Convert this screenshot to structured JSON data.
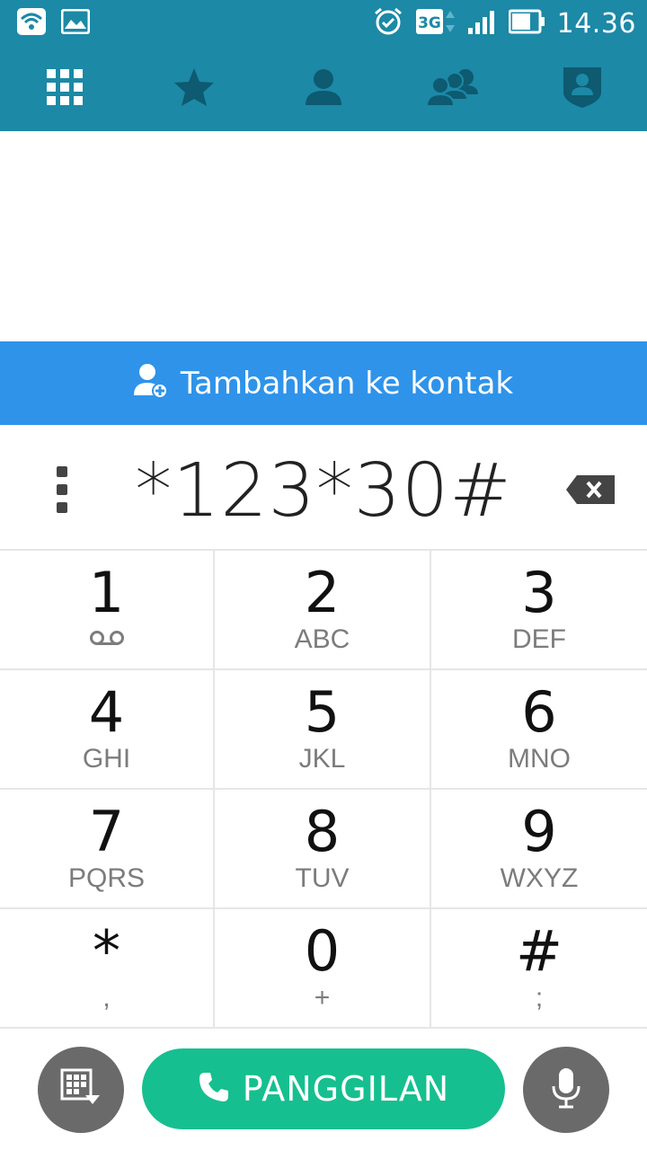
{
  "status_bar": {
    "time": "14.36",
    "network": "3G",
    "icons": [
      "wifi-icon",
      "image-notification-icon",
      "alarm-icon",
      "network-3g-icon",
      "signal-icon",
      "battery-icon"
    ]
  },
  "tabs": [
    {
      "name": "dialpad",
      "icon": "dialpad-grid-icon",
      "active": true
    },
    {
      "name": "favorites",
      "icon": "star-icon"
    },
    {
      "name": "contacts",
      "icon": "person-icon"
    },
    {
      "name": "groups",
      "icon": "group-icon"
    },
    {
      "name": "profile",
      "icon": "shield-person-icon"
    }
  ],
  "add_contact": {
    "label": "Tambahkan ke kontak",
    "icon": "add-person-icon"
  },
  "dialer": {
    "number": "*123*30#"
  },
  "keypad": [
    {
      "digit": "1",
      "sub": "",
      "sub_icon": "voicemail-icon"
    },
    {
      "digit": "2",
      "sub": "ABC"
    },
    {
      "digit": "3",
      "sub": "DEF"
    },
    {
      "digit": "4",
      "sub": "GHI"
    },
    {
      "digit": "5",
      "sub": "JKL"
    },
    {
      "digit": "6",
      "sub": "MNO"
    },
    {
      "digit": "7",
      "sub": "PQRS"
    },
    {
      "digit": "8",
      "sub": "TUV"
    },
    {
      "digit": "9",
      "sub": "WXYZ"
    },
    {
      "digit": "*",
      "sub": ","
    },
    {
      "digit": "0",
      "sub": "+"
    },
    {
      "digit": "#",
      "sub": ";"
    }
  ],
  "bottom": {
    "call_label": "PANGGILAN",
    "left_icon": "hide-keypad-icon",
    "right_icon": "microphone-icon"
  },
  "colors": {
    "header": "#1c89a6",
    "tab_icon": "#0e5a70",
    "add_contact": "#2f93ea",
    "call_button": "#16bf8f",
    "round_button": "#6a6a6a"
  }
}
